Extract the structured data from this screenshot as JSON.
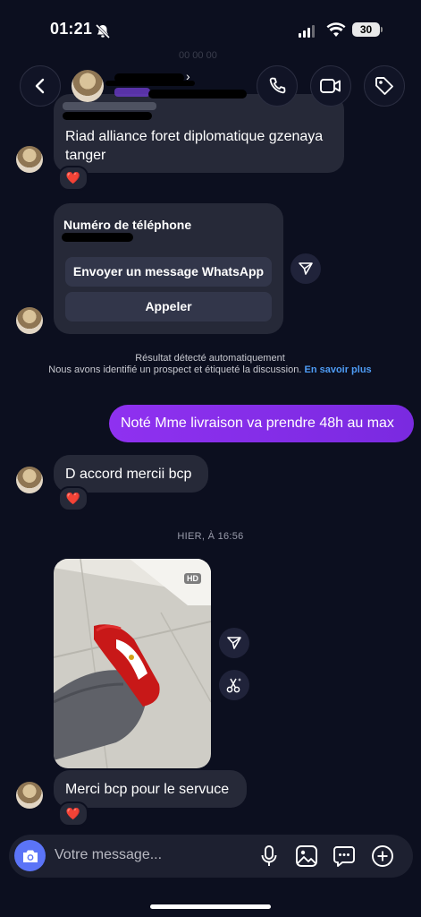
{
  "status_bar": {
    "time": "01:21",
    "battery": "30"
  },
  "header": {
    "back_icon": "chevron-left-icon",
    "call_icon": "phone-icon",
    "video_icon": "video-camera-icon",
    "tag_icon": "tag-icon",
    "faded_timestamp": "00 00 00"
  },
  "messages": {
    "address_text": "Riad alliance foret diplomatique gzenaya tanger",
    "address_reaction": "❤️",
    "phone_card": {
      "title": "Numéro de téléphone",
      "whatsapp_button": "Envoyer un message WhatsApp",
      "call_button": "Appeler"
    },
    "system_notice": {
      "line1": "Résultat détecté automatiquement",
      "line2": "Nous avons identifié un prospect et étiqueté la discussion.",
      "link": "En savoir plus"
    },
    "outgoing_1": "Noté Mme livraison va prendre 48h au max",
    "incoming_2": "D accord mercii bcp",
    "incoming_2_reaction": "❤️",
    "timestamp": "HIER, À 16:56",
    "photo_badge": "HD",
    "incoming_3": "Merci bcp pour le servuce",
    "incoming_3_reaction": "❤️"
  },
  "composer": {
    "placeholder": "Votre message...",
    "icons": [
      "camera-icon",
      "microphone-icon",
      "gallery-icon",
      "sticker-chat-icon",
      "plus-circle-icon"
    ]
  },
  "colors": {
    "background": "#0c0f1f",
    "incoming_bubble": "#262938",
    "outgoing_bubble": "#8a2be2",
    "link": "#4e9cf5",
    "camera_button": "#5b74f7"
  }
}
